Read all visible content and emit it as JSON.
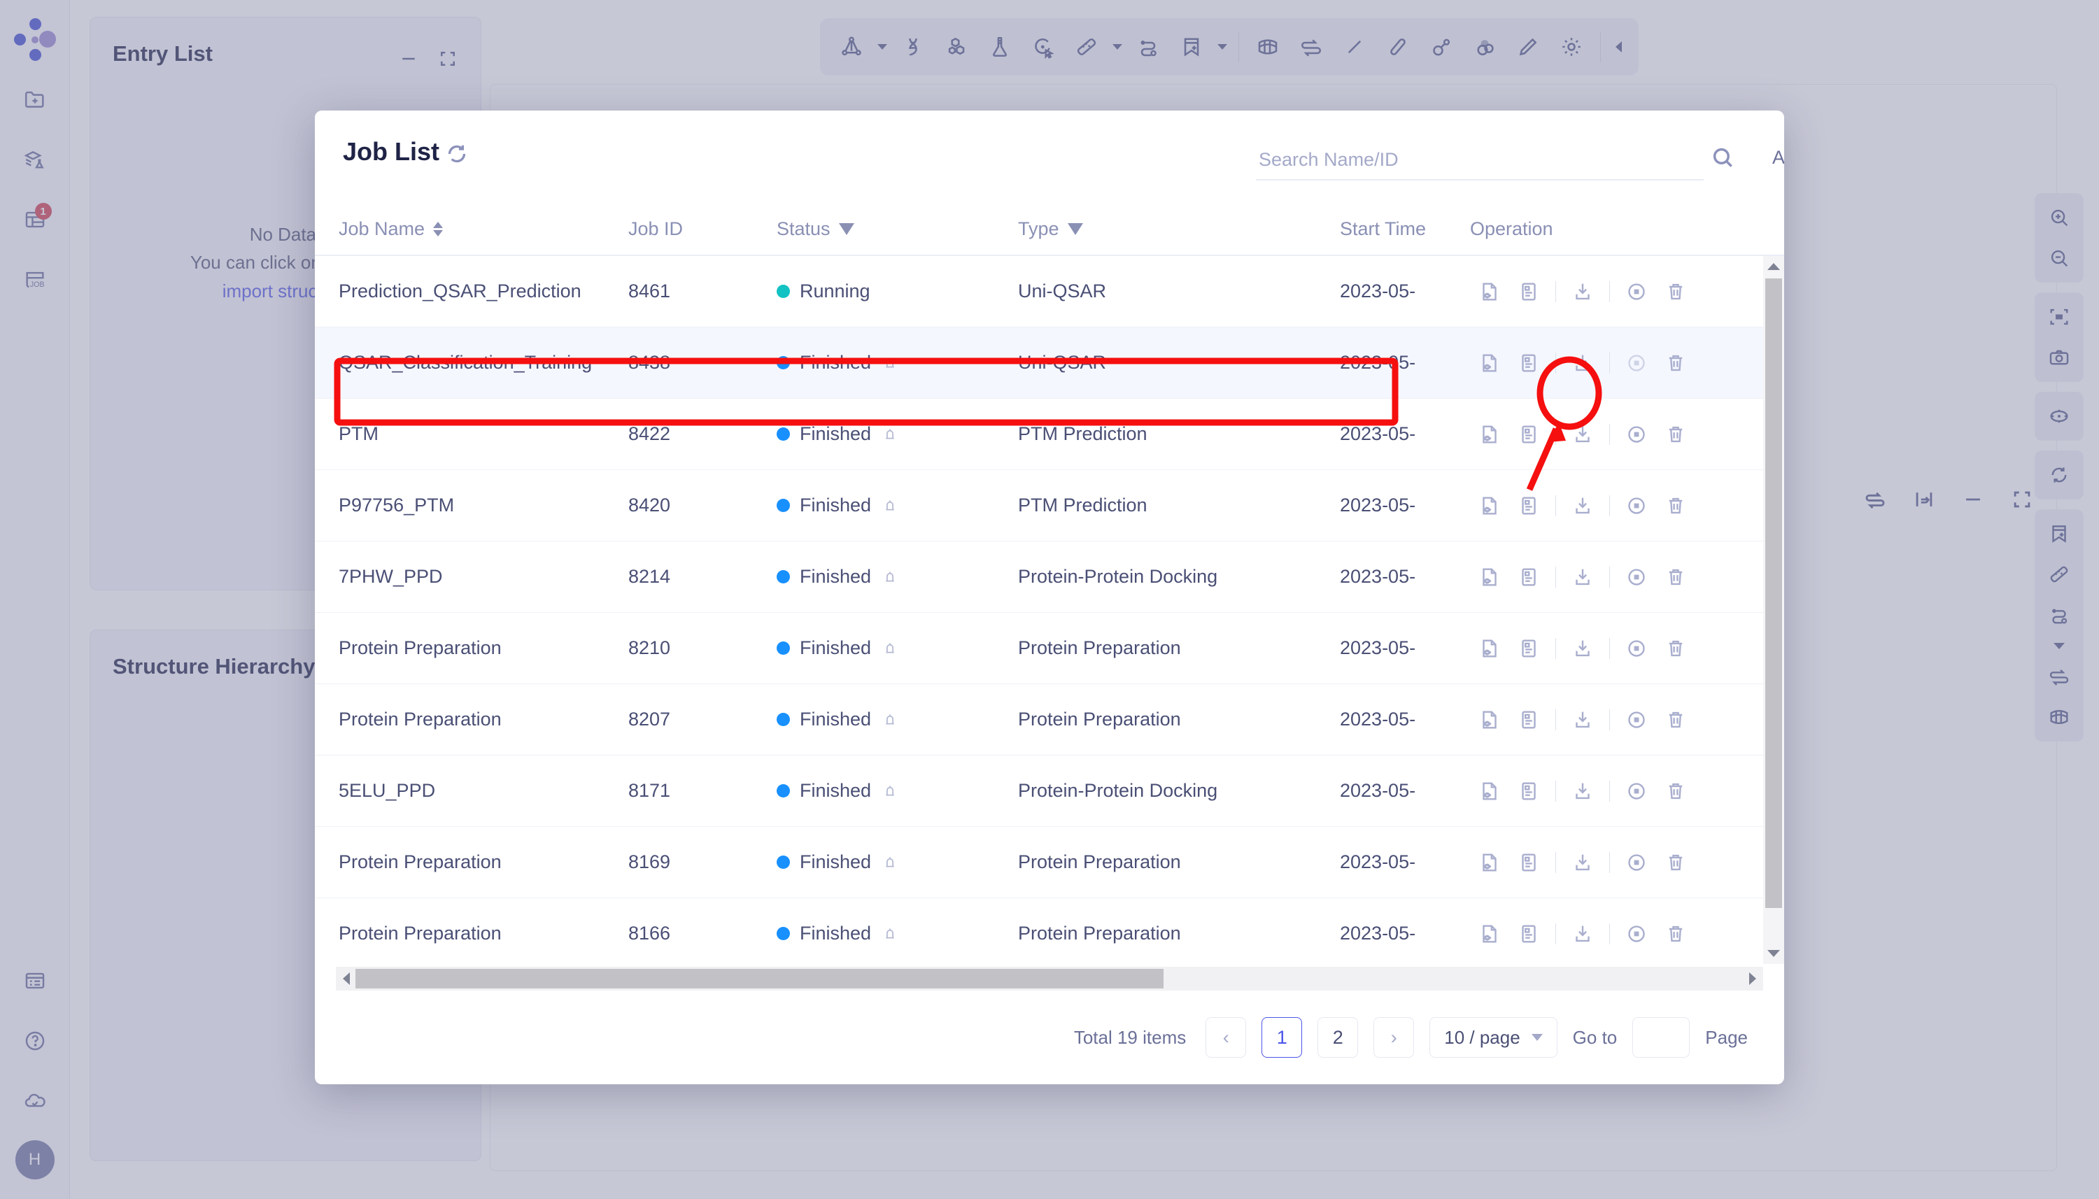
{
  "app": {
    "left_rail": {
      "logo": "molecule-logo",
      "items": [
        {
          "name": "new-folder-icon",
          "label": "New Folder"
        },
        {
          "name": "layers-flask-icon",
          "label": "Experiments"
        },
        {
          "name": "table-panel-icon",
          "label": "Data Table",
          "badge": "1"
        },
        {
          "name": "job-icon",
          "label": "JOB"
        }
      ],
      "bottom_items": [
        {
          "name": "list-panel-icon",
          "label": "Records"
        },
        {
          "name": "help-circle-icon",
          "label": "Help"
        },
        {
          "name": "cloud-check-icon",
          "label": "Cloud Sync"
        }
      ],
      "avatar_initial": "H"
    },
    "top_toolbar": {
      "items": [
        {
          "name": "structure-node-icon",
          "caret": true
        },
        {
          "name": "dna-icon",
          "caret": false
        },
        {
          "name": "hexagon-molecule-icon",
          "caret": false
        },
        {
          "name": "flask-icon",
          "caret": false
        },
        {
          "name": "select-pointer-icon",
          "caret": false
        },
        {
          "name": "ruler-icon",
          "caret": true
        },
        {
          "name": "path-link-icon",
          "caret": false
        },
        {
          "name": "bookmark-plus-icon",
          "caret": true
        },
        {
          "name": "surface-mesh-icon",
          "caret": false
        },
        {
          "name": "swap-arrows-icon",
          "caret": false
        },
        {
          "name": "line-icon",
          "caret": false
        },
        {
          "name": "stick-icon",
          "caret": false
        },
        {
          "name": "ball-stick-icon",
          "caret": false
        },
        {
          "name": "spacefill-icon",
          "caret": false
        },
        {
          "name": "pencil-icon",
          "caret": false
        },
        {
          "name": "gear-icon",
          "caret": false
        }
      ],
      "collapse": "collapse-toolbar-icon"
    },
    "right_rail": {
      "groups": [
        [
          "zoom-in-icon",
          "zoom-out-icon"
        ],
        [
          "fit-screen-icon",
          "camera-icon"
        ],
        [
          "center-target-icon"
        ],
        [
          "refresh-rotate-icon"
        ],
        [
          "bookmark-plus-icon",
          "ruler-icon",
          "path-link-icon",
          "caret-down-icon",
          "swap-arrows-icon",
          "surface-mesh-icon"
        ]
      ]
    },
    "bottom_right_controls": [
      "swap-arrows-icon",
      "fit-width-icon",
      "minimize-icon",
      "fullscreen-icon"
    ],
    "panels": [
      {
        "title": "Entry List",
        "empty_line1": "No Data.",
        "empty_line2": "You can click on the left",
        "empty_link": "import structure",
        "controls": [
          "minimize-icon",
          "fullscreen-icon"
        ]
      },
      {
        "title": "Structure Hierarchy",
        "controls": []
      }
    ]
  },
  "modal": {
    "title": "Job List",
    "refresh_icon": "refresh-icon",
    "search": {
      "placeholder": "Search Name/ID",
      "value": "",
      "icon": "search-icon"
    },
    "advanced_search_label": "Advanced Search",
    "close_icon": "close-icon",
    "columns": [
      {
        "key": "name",
        "label": "Job Name",
        "sortable": true,
        "filterable": false
      },
      {
        "key": "id",
        "label": "Job ID",
        "sortable": false,
        "filterable": false
      },
      {
        "key": "status",
        "label": "Status",
        "sortable": false,
        "filterable": true
      },
      {
        "key": "type",
        "label": "Type",
        "sortable": false,
        "filterable": true
      },
      {
        "key": "startTime",
        "label": "Start Time",
        "sortable": false,
        "filterable": false
      },
      {
        "key": "operation",
        "label": "Operation",
        "sortable": false,
        "filterable": false
      }
    ],
    "operation_icons": [
      "preview-file-icon",
      "report-log-icon",
      "download-icon",
      "stop-circle-icon",
      "delete-trash-icon"
    ],
    "status_colors": {
      "Running": "#13c2c2",
      "Finished": "#1890ff"
    },
    "rows": [
      {
        "name": "Prediction_QSAR_Prediction",
        "id": "8461",
        "status": "Running",
        "bell": false,
        "type": "Uni-QSAR",
        "startTime": "2023-05-",
        "highlighted": false
      },
      {
        "name": "QSAR_Classification_Training",
        "id": "8438",
        "status": "Finished",
        "bell": true,
        "type": "Uni-QSAR",
        "startTime": "2023-05-",
        "highlighted": true
      },
      {
        "name": "PTM",
        "id": "8422",
        "status": "Finished",
        "bell": true,
        "type": "PTM Prediction",
        "startTime": "2023-05-",
        "highlighted": false
      },
      {
        "name": "P97756_PTM",
        "id": "8420",
        "status": "Finished",
        "bell": true,
        "type": "PTM Prediction",
        "startTime": "2023-05-",
        "highlighted": false
      },
      {
        "name": "7PHW_PPD",
        "id": "8214",
        "status": "Finished",
        "bell": true,
        "type": "Protein-Protein Docking",
        "startTime": "2023-05-",
        "highlighted": false
      },
      {
        "name": "Protein Preparation",
        "id": "8210",
        "status": "Finished",
        "bell": true,
        "type": "Protein Preparation",
        "startTime": "2023-05-",
        "highlighted": false
      },
      {
        "name": "Protein Preparation",
        "id": "8207",
        "status": "Finished",
        "bell": true,
        "type": "Protein Preparation",
        "startTime": "2023-05-",
        "highlighted": false
      },
      {
        "name": "5ELU_PPD",
        "id": "8171",
        "status": "Finished",
        "bell": true,
        "type": "Protein-Protein Docking",
        "startTime": "2023-05-",
        "highlighted": false
      },
      {
        "name": "Protein Preparation",
        "id": "8169",
        "status": "Finished",
        "bell": true,
        "type": "Protein Preparation",
        "startTime": "2023-05-",
        "highlighted": false
      },
      {
        "name": "Protein Preparation",
        "id": "8166",
        "status": "Finished",
        "bell": true,
        "type": "Protein Preparation",
        "startTime": "2023-05-",
        "highlighted": false
      }
    ],
    "pagination": {
      "total_label": "Total 19 items",
      "prev": "‹",
      "pages": [
        "1",
        "2"
      ],
      "current_page": "1",
      "next": "›",
      "page_size": "10 / page",
      "goto_label": "Go to",
      "goto_value": "",
      "page_suffix": "Page"
    }
  },
  "annotation": {
    "highlight_target": "download-icon",
    "highlight_color": "#f50f0f"
  }
}
